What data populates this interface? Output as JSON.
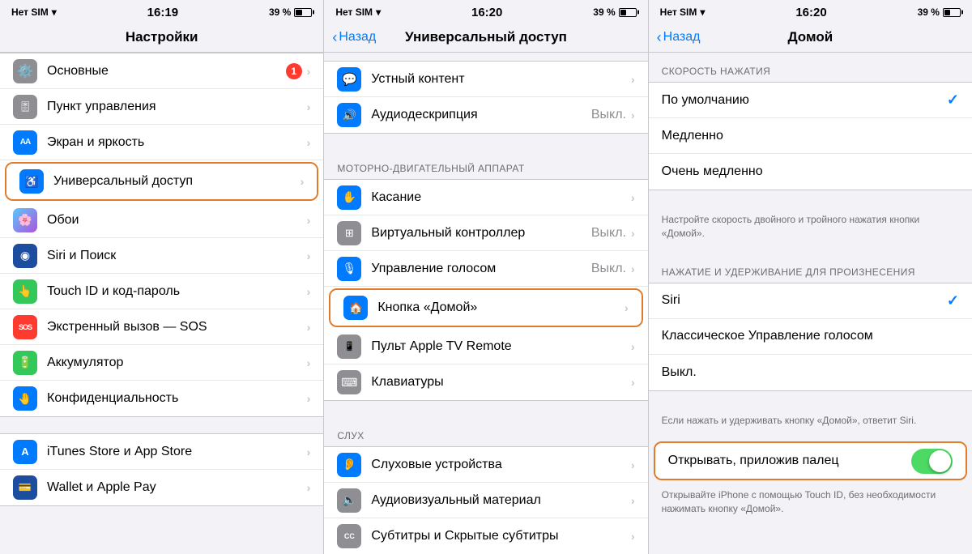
{
  "panel1": {
    "status": {
      "carrier": "Нет SIM",
      "time": "16:19",
      "battery": "39 %",
      "wifi": true
    },
    "title": "Настройки",
    "rows": [
      {
        "id": "general",
        "icon": "⚙️",
        "iconBg": "gray",
        "label": "Основные",
        "badge": "1",
        "value": "",
        "hasChevron": true
      },
      {
        "id": "control-center",
        "icon": "🎚",
        "iconBg": "gray",
        "label": "Пункт управления",
        "badge": "",
        "value": "",
        "hasChevron": true
      },
      {
        "id": "display",
        "icon": "AA",
        "iconBg": "blue",
        "label": "Экран и яркость",
        "badge": "",
        "value": "",
        "hasChevron": true
      },
      {
        "id": "accessibility",
        "icon": "♿",
        "iconBg": "blue",
        "label": "Универсальный доступ",
        "badge": "",
        "value": "",
        "hasChevron": true,
        "selected": true
      },
      {
        "id": "wallpaper",
        "icon": "🌸",
        "iconBg": "teal",
        "label": "Обои",
        "badge": "",
        "value": "",
        "hasChevron": true
      },
      {
        "id": "siri",
        "icon": "◉",
        "iconBg": "dark-blue",
        "label": "Siri и Поиск",
        "badge": "",
        "value": "",
        "hasChevron": true
      },
      {
        "id": "touchid",
        "icon": "👆",
        "iconBg": "green",
        "label": "Touch ID и код-пароль",
        "badge": "",
        "value": "",
        "hasChevron": true
      },
      {
        "id": "sos",
        "icon": "SOS",
        "iconBg": "red",
        "label": "Экстренный вызов — SOS",
        "badge": "",
        "value": "",
        "hasChevron": true
      },
      {
        "id": "battery",
        "icon": "🔋",
        "iconBg": "green",
        "label": "Аккумулятор",
        "badge": "",
        "value": "",
        "hasChevron": true
      },
      {
        "id": "privacy",
        "icon": "🤚",
        "iconBg": "blue",
        "label": "Конфиденциальность",
        "badge": "",
        "value": "",
        "hasChevron": true
      }
    ],
    "rows2": [
      {
        "id": "itunes",
        "icon": "A",
        "iconBg": "blue",
        "label": "iTunes Store и App Store",
        "badge": "",
        "value": "",
        "hasChevron": true
      },
      {
        "id": "wallet",
        "icon": "💳",
        "iconBg": "dark-blue",
        "label": "Wallet и Apple Pay",
        "badge": "",
        "value": "",
        "hasChevron": true
      }
    ]
  },
  "panel2": {
    "status": {
      "carrier": "Нет SIM",
      "time": "16:20",
      "battery": "39 %"
    },
    "back": "Назад",
    "title": "Универсальный доступ",
    "rows1": [
      {
        "id": "spoken",
        "icon": "💬",
        "iconBg": "blue",
        "label": "Устный контент",
        "value": "",
        "hasChevron": true
      },
      {
        "id": "audiodesc",
        "icon": "🔊",
        "iconBg": "blue",
        "label": "Аудиодескрипция",
        "value": "Выкл.",
        "hasChevron": true
      }
    ],
    "section2": "МОТОРНО-ДВИГАТЕЛЬНЫЙ АППАРАТ",
    "rows2": [
      {
        "id": "touch",
        "icon": "✋",
        "iconBg": "blue",
        "label": "Касание",
        "value": "",
        "hasChevron": true
      },
      {
        "id": "switch",
        "icon": "⊞",
        "iconBg": "gray",
        "label": "Виртуальный контроллер",
        "value": "Выкл.",
        "hasChevron": true
      },
      {
        "id": "voice",
        "icon": "🎙",
        "iconBg": "blue",
        "label": "Управление голосом",
        "value": "Выкл.",
        "hasChevron": true
      },
      {
        "id": "home",
        "icon": "🏠",
        "iconBg": "blue",
        "label": "Кнопка «Домой»",
        "value": "",
        "hasChevron": true,
        "selected": true
      },
      {
        "id": "remote",
        "icon": "📱",
        "iconBg": "gray",
        "label": "Пульт Apple TV Remote",
        "value": "",
        "hasChevron": true
      },
      {
        "id": "keyboard",
        "icon": "⌨",
        "iconBg": "gray",
        "label": "Клавиатуры",
        "value": "",
        "hasChevron": true
      }
    ],
    "section3": "СЛУХ",
    "rows3": [
      {
        "id": "hearing",
        "icon": "👂",
        "iconBg": "blue",
        "label": "Слуховые устройства",
        "value": "",
        "hasChevron": true
      },
      {
        "id": "av",
        "icon": "🔈",
        "iconBg": "gray",
        "label": "Аудиовизуальный материал",
        "value": "",
        "hasChevron": true
      },
      {
        "id": "subtitles",
        "icon": "CC",
        "iconBg": "gray",
        "label": "Субтитры и Скрытые субтитры",
        "value": "",
        "hasChevron": true
      }
    ]
  },
  "panel3": {
    "status": {
      "carrier": "Нет SIM",
      "time": "16:20",
      "battery": "39 %"
    },
    "back": "Назад",
    "title": "Домой",
    "section1": "СКОРОСТЬ НАЖАТИЯ",
    "speed_rows": [
      {
        "id": "default",
        "label": "По умолчанию",
        "checked": true
      },
      {
        "id": "slow",
        "label": "Медленно",
        "checked": false
      },
      {
        "id": "very-slow",
        "label": "Очень медленно",
        "checked": false
      }
    ],
    "speed_footer": "Настройте скорость двойного и тройного нажатия кнопки «Домой».",
    "section2": "НАЖАТИЕ И УДЕРЖИВАНИЕ ДЛЯ ПРОИЗНЕСЕНИЯ",
    "press_rows": [
      {
        "id": "siri",
        "label": "Siri",
        "checked": true
      },
      {
        "id": "voice-classic",
        "label": "Классическое Управление голосом",
        "checked": false
      },
      {
        "id": "off",
        "label": "Выкл.",
        "checked": false
      }
    ],
    "press_footer": "Если нажать и удерживать кнопку «Домой», ответит Siri.",
    "toggle_row": {
      "label": "Открывать, приложив палец",
      "enabled": true,
      "selected": true
    },
    "toggle_footer": "Открывайте iPhone с помощью Touch ID, без необходимости нажимать кнопку «Домой»."
  }
}
